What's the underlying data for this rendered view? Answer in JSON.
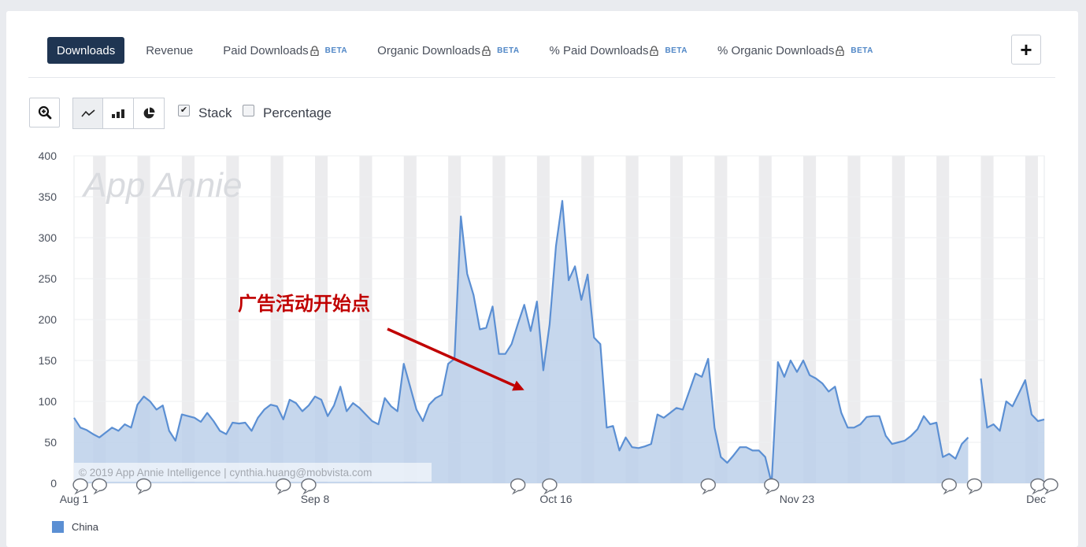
{
  "tabs": [
    {
      "label": "Downloads",
      "active": true
    },
    {
      "label": "Revenue"
    },
    {
      "label": "Paid Downloads",
      "locked": true,
      "badge": "BETA"
    },
    {
      "label": "Organic Downloads",
      "locked": true,
      "badge": "BETA"
    },
    {
      "label": "% Paid Downloads",
      "locked": true,
      "badge": "BETA"
    },
    {
      "label": "% Organic Downloads",
      "locked": true,
      "badge": "BETA"
    }
  ],
  "toolbar": {
    "add_label": "+",
    "stack_label": "Stack",
    "stack_checked": true,
    "percentage_label": "Percentage",
    "percentage_checked": false
  },
  "icons": {
    "zoom": "zoom-in-icon",
    "line": "line-chart-icon",
    "bar": "bar-chart-icon",
    "pie": "pie-chart-icon",
    "lock": "lock-icon",
    "add": "plus-icon"
  },
  "colors": {
    "series_line": "#5b8fd3",
    "series_fill": "#bcd0ea",
    "annotation": "#c00000",
    "active_tab": "#1f3552"
  },
  "chart_data": {
    "type": "area",
    "stacked": true,
    "title": "",
    "xlabel": "",
    "ylabel": "",
    "ylim": [
      0,
      400
    ],
    "yticks": [
      0,
      50,
      100,
      150,
      200,
      250,
      300,
      350,
      400
    ],
    "x_tick_labels": [
      "Aug 1",
      "Sep 8",
      "Oct 16",
      "Nov 23",
      "Dec"
    ],
    "watermark": "App Annie",
    "copyright": "© 2019 App Annie Intelligence | cynthia.huang@mobvista.com",
    "annotation": {
      "text": "广告活动开始点",
      "day": 71,
      "value": 108
    },
    "legend": [
      {
        "name": "China",
        "color": "#5b8fd3"
      }
    ],
    "weekend_bands": true,
    "grid": true,
    "gaps": [
      {
        "from": 141,
        "to": 143
      }
    ],
    "note_markers_days": [
      1,
      4,
      11,
      33,
      37,
      70,
      75,
      100,
      110,
      138,
      142,
      152,
      154,
      169,
      176,
      178,
      195
    ],
    "series": [
      {
        "name": "China",
        "values": [
          80,
          68,
          65,
          60,
          56,
          62,
          68,
          64,
          72,
          68,
          96,
          106,
          100,
          90,
          95,
          64,
          52,
          84,
          82,
          80,
          75,
          86,
          76,
          64,
          60,
          74,
          73,
          74,
          64,
          80,
          90,
          96,
          94,
          78,
          102,
          98,
          88,
          95,
          106,
          102,
          82,
          95,
          118,
          88,
          98,
          92,
          84,
          76,
          72,
          104,
          94,
          88,
          146,
          118,
          90,
          76,
          96,
          104,
          108,
          146,
          152,
          326,
          256,
          230,
          188,
          190,
          216,
          158,
          158,
          170,
          195,
          218,
          186,
          222,
          138,
          194,
          290,
          345,
          248,
          265,
          224,
          255,
          178,
          170,
          68,
          70,
          40,
          56,
          44,
          43,
          45,
          48,
          84,
          80,
          86,
          92,
          90,
          112,
          134,
          130,
          152,
          68,
          32,
          25,
          34,
          44,
          44,
          40,
          40,
          32,
          0,
          148,
          130,
          150,
          136,
          150,
          132,
          128,
          122,
          112,
          118,
          86,
          68,
          68,
          72,
          81,
          82,
          82,
          58,
          48,
          50,
          52,
          58,
          66,
          82,
          72,
          74,
          32,
          36,
          30,
          48,
          56,
          66,
          128,
          68,
          72,
          64,
          100,
          94,
          110,
          126,
          84,
          76,
          78
        ]
      }
    ]
  }
}
